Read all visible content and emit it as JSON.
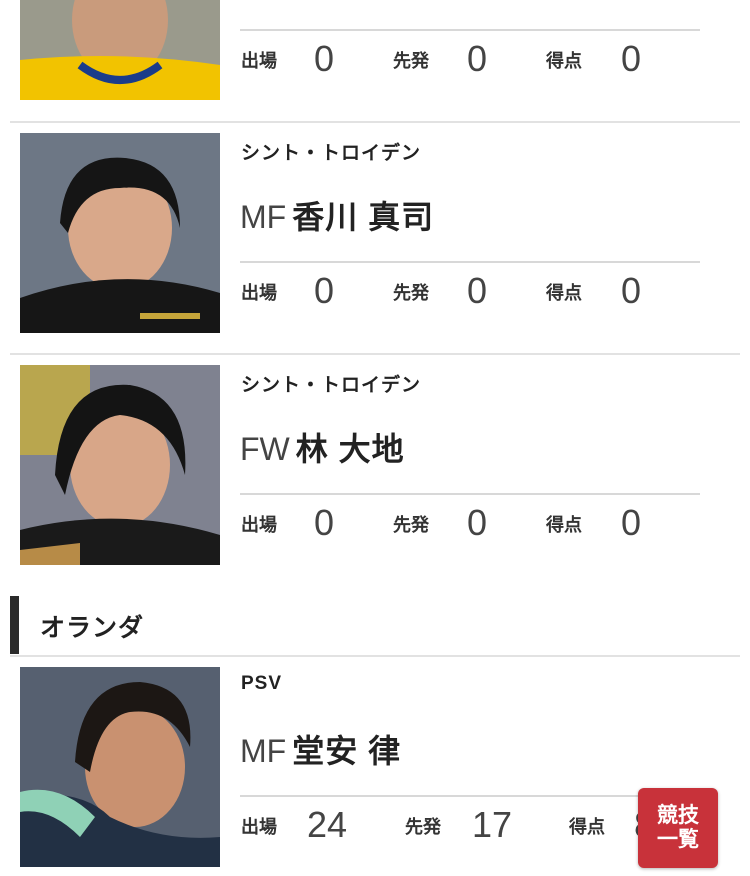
{
  "players": [
    {
      "team": "",
      "position": "",
      "name": "",
      "photo_icon": "player-photo-icon",
      "stats": [
        {
          "label": "出場",
          "value": "0"
        },
        {
          "label": "先発",
          "value": "0"
        },
        {
          "label": "得点",
          "value": "0"
        }
      ]
    },
    {
      "team": "シント・トロイデン",
      "position": "MF",
      "name": "香川 真司",
      "photo_icon": "player-photo-icon",
      "stats": [
        {
          "label": "出場",
          "value": "0"
        },
        {
          "label": "先発",
          "value": "0"
        },
        {
          "label": "得点",
          "value": "0"
        }
      ]
    },
    {
      "team": "シント・トロイデン",
      "position": "FW",
      "name": "林 大地",
      "photo_icon": "player-photo-icon",
      "stats": [
        {
          "label": "出場",
          "value": "0"
        },
        {
          "label": "先発",
          "value": "0"
        },
        {
          "label": "得点",
          "value": "0"
        }
      ]
    },
    {
      "team": "PSV",
      "position": "MF",
      "name": "堂安 律",
      "photo_icon": "player-photo-icon",
      "stats": [
        {
          "label": "出場",
          "value": "24"
        },
        {
          "label": "先発",
          "value": "17"
        },
        {
          "label": "得点",
          "value": "8"
        }
      ]
    }
  ],
  "section": {
    "title": "オランダ"
  },
  "floating_button": {
    "line1": "競技",
    "line2": "一覧"
  },
  "colors": {
    "accent": "#c8323a",
    "section_bar": "#2b2b2b",
    "divider": "#d8d8d8"
  }
}
